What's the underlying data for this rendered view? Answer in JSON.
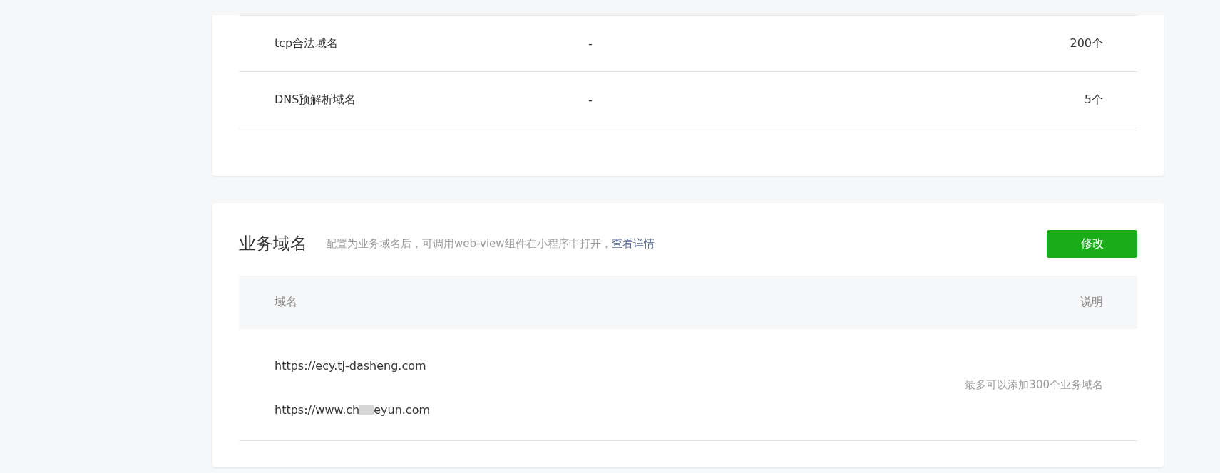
{
  "limits_table": {
    "rows": [
      {
        "name": "tcp合法域名",
        "value": "-",
        "limit": "200个"
      },
      {
        "name": "DNS预解析域名",
        "value": "-",
        "limit": "5个"
      }
    ]
  },
  "business_domains": {
    "title": "业务域名",
    "description": "配置为业务域名后，可调用web-view组件在小程序中打开，",
    "link": "查看详情",
    "edit_button": "修改",
    "columns": [
      "域名",
      "说明"
    ],
    "domains": [
      {
        "prefix": "https://ecy.tj-dasheng.com"
      },
      {
        "prefix": "https://www.ch",
        "suffix": "eyun.com"
      }
    ],
    "note": "最多可以添加300个业务域名"
  }
}
